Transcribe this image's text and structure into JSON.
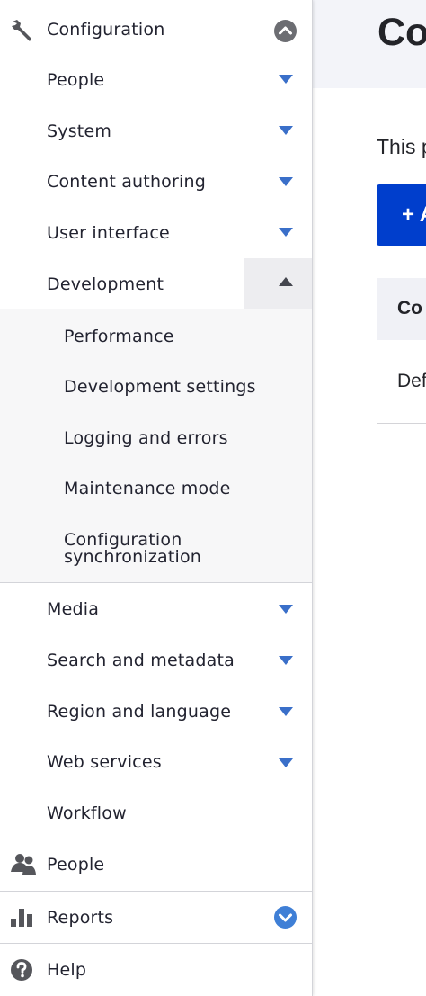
{
  "sidebar": {
    "configuration": {
      "label": "Configuration",
      "icon": "wrench-icon",
      "toggle_icon": "chevron-up-circle-icon"
    },
    "config_items": [
      {
        "label": "People",
        "state": "collapsed"
      },
      {
        "label": "System",
        "state": "collapsed"
      },
      {
        "label": "Content authoring",
        "state": "collapsed"
      },
      {
        "label": "User interface",
        "state": "collapsed"
      },
      {
        "label": "Development",
        "state": "expanded"
      },
      {
        "label": "Media",
        "state": "collapsed"
      },
      {
        "label": "Search and metadata",
        "state": "collapsed"
      },
      {
        "label": "Region and language",
        "state": "collapsed"
      },
      {
        "label": "Web services",
        "state": "collapsed"
      },
      {
        "label": "Workflow",
        "state": "none"
      }
    ],
    "development_items": [
      {
        "label": "Performance"
      },
      {
        "label": "Development settings"
      },
      {
        "label": "Logging and errors"
      },
      {
        "label": "Maintenance mode"
      },
      {
        "label": "Configuration",
        "label2": "synchronization"
      }
    ],
    "people": {
      "label": "People",
      "icon": "people-icon"
    },
    "reports": {
      "label": "Reports",
      "icon": "bar-chart-icon",
      "toggle_icon": "chevron-down-circle-icon"
    },
    "help": {
      "label": "Help",
      "icon": "question-circle-icon"
    }
  },
  "main": {
    "title": "Co",
    "intro": "This p",
    "add_button": "+ A",
    "table_header": "Co",
    "table_cell": "Def"
  },
  "colors": {
    "accent": "#003ecc",
    "arrow_blue": "#3a6fc9",
    "header_bg": "#f3f4f9",
    "submenu_bg": "#f7f7f8"
  }
}
